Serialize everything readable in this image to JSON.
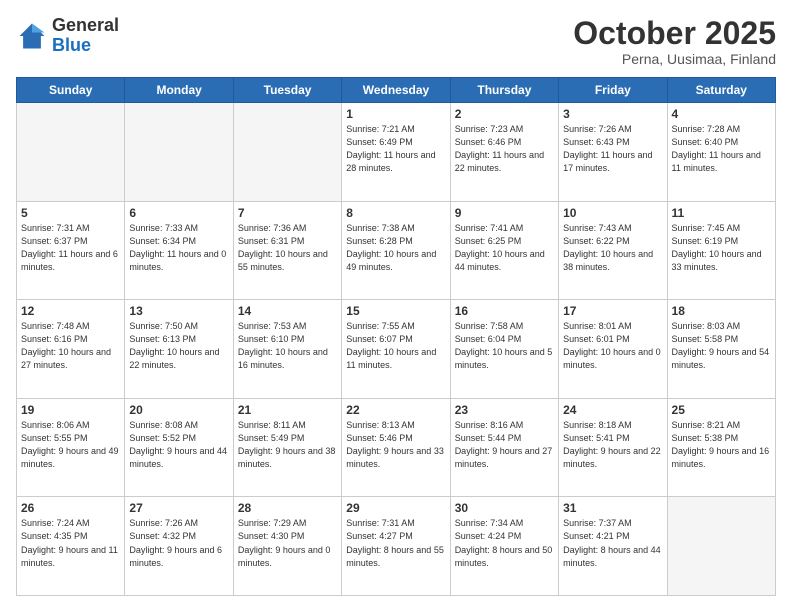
{
  "header": {
    "logo_general": "General",
    "logo_blue": "Blue",
    "month_title": "October 2025",
    "location": "Perna, Uusimaa, Finland"
  },
  "weekdays": [
    "Sunday",
    "Monday",
    "Tuesday",
    "Wednesday",
    "Thursday",
    "Friday",
    "Saturday"
  ],
  "weeks": [
    [
      {
        "day": "",
        "sunrise": "",
        "sunset": "",
        "daylight": "",
        "empty": true
      },
      {
        "day": "",
        "sunrise": "",
        "sunset": "",
        "daylight": "",
        "empty": true
      },
      {
        "day": "",
        "sunrise": "",
        "sunset": "",
        "daylight": "",
        "empty": true
      },
      {
        "day": "1",
        "sunrise": "Sunrise: 7:21 AM",
        "sunset": "Sunset: 6:49 PM",
        "daylight": "Daylight: 11 hours and 28 minutes.",
        "empty": false
      },
      {
        "day": "2",
        "sunrise": "Sunrise: 7:23 AM",
        "sunset": "Sunset: 6:46 PM",
        "daylight": "Daylight: 11 hours and 22 minutes.",
        "empty": false
      },
      {
        "day": "3",
        "sunrise": "Sunrise: 7:26 AM",
        "sunset": "Sunset: 6:43 PM",
        "daylight": "Daylight: 11 hours and 17 minutes.",
        "empty": false
      },
      {
        "day": "4",
        "sunrise": "Sunrise: 7:28 AM",
        "sunset": "Sunset: 6:40 PM",
        "daylight": "Daylight: 11 hours and 11 minutes.",
        "empty": false
      }
    ],
    [
      {
        "day": "5",
        "sunrise": "Sunrise: 7:31 AM",
        "sunset": "Sunset: 6:37 PM",
        "daylight": "Daylight: 11 hours and 6 minutes.",
        "empty": false
      },
      {
        "day": "6",
        "sunrise": "Sunrise: 7:33 AM",
        "sunset": "Sunset: 6:34 PM",
        "daylight": "Daylight: 11 hours and 0 minutes.",
        "empty": false
      },
      {
        "day": "7",
        "sunrise": "Sunrise: 7:36 AM",
        "sunset": "Sunset: 6:31 PM",
        "daylight": "Daylight: 10 hours and 55 minutes.",
        "empty": false
      },
      {
        "day": "8",
        "sunrise": "Sunrise: 7:38 AM",
        "sunset": "Sunset: 6:28 PM",
        "daylight": "Daylight: 10 hours and 49 minutes.",
        "empty": false
      },
      {
        "day": "9",
        "sunrise": "Sunrise: 7:41 AM",
        "sunset": "Sunset: 6:25 PM",
        "daylight": "Daylight: 10 hours and 44 minutes.",
        "empty": false
      },
      {
        "day": "10",
        "sunrise": "Sunrise: 7:43 AM",
        "sunset": "Sunset: 6:22 PM",
        "daylight": "Daylight: 10 hours and 38 minutes.",
        "empty": false
      },
      {
        "day": "11",
        "sunrise": "Sunrise: 7:45 AM",
        "sunset": "Sunset: 6:19 PM",
        "daylight": "Daylight: 10 hours and 33 minutes.",
        "empty": false
      }
    ],
    [
      {
        "day": "12",
        "sunrise": "Sunrise: 7:48 AM",
        "sunset": "Sunset: 6:16 PM",
        "daylight": "Daylight: 10 hours and 27 minutes.",
        "empty": false
      },
      {
        "day": "13",
        "sunrise": "Sunrise: 7:50 AM",
        "sunset": "Sunset: 6:13 PM",
        "daylight": "Daylight: 10 hours and 22 minutes.",
        "empty": false
      },
      {
        "day": "14",
        "sunrise": "Sunrise: 7:53 AM",
        "sunset": "Sunset: 6:10 PM",
        "daylight": "Daylight: 10 hours and 16 minutes.",
        "empty": false
      },
      {
        "day": "15",
        "sunrise": "Sunrise: 7:55 AM",
        "sunset": "Sunset: 6:07 PM",
        "daylight": "Daylight: 10 hours and 11 minutes.",
        "empty": false
      },
      {
        "day": "16",
        "sunrise": "Sunrise: 7:58 AM",
        "sunset": "Sunset: 6:04 PM",
        "daylight": "Daylight: 10 hours and 5 minutes.",
        "empty": false
      },
      {
        "day": "17",
        "sunrise": "Sunrise: 8:01 AM",
        "sunset": "Sunset: 6:01 PM",
        "daylight": "Daylight: 10 hours and 0 minutes.",
        "empty": false
      },
      {
        "day": "18",
        "sunrise": "Sunrise: 8:03 AM",
        "sunset": "Sunset: 5:58 PM",
        "daylight": "Daylight: 9 hours and 54 minutes.",
        "empty": false
      }
    ],
    [
      {
        "day": "19",
        "sunrise": "Sunrise: 8:06 AM",
        "sunset": "Sunset: 5:55 PM",
        "daylight": "Daylight: 9 hours and 49 minutes.",
        "empty": false
      },
      {
        "day": "20",
        "sunrise": "Sunrise: 8:08 AM",
        "sunset": "Sunset: 5:52 PM",
        "daylight": "Daylight: 9 hours and 44 minutes.",
        "empty": false
      },
      {
        "day": "21",
        "sunrise": "Sunrise: 8:11 AM",
        "sunset": "Sunset: 5:49 PM",
        "daylight": "Daylight: 9 hours and 38 minutes.",
        "empty": false
      },
      {
        "day": "22",
        "sunrise": "Sunrise: 8:13 AM",
        "sunset": "Sunset: 5:46 PM",
        "daylight": "Daylight: 9 hours and 33 minutes.",
        "empty": false
      },
      {
        "day": "23",
        "sunrise": "Sunrise: 8:16 AM",
        "sunset": "Sunset: 5:44 PM",
        "daylight": "Daylight: 9 hours and 27 minutes.",
        "empty": false
      },
      {
        "day": "24",
        "sunrise": "Sunrise: 8:18 AM",
        "sunset": "Sunset: 5:41 PM",
        "daylight": "Daylight: 9 hours and 22 minutes.",
        "empty": false
      },
      {
        "day": "25",
        "sunrise": "Sunrise: 8:21 AM",
        "sunset": "Sunset: 5:38 PM",
        "daylight": "Daylight: 9 hours and 16 minutes.",
        "empty": false
      }
    ],
    [
      {
        "day": "26",
        "sunrise": "Sunrise: 7:24 AM",
        "sunset": "Sunset: 4:35 PM",
        "daylight": "Daylight: 9 hours and 11 minutes.",
        "empty": false,
        "last": true
      },
      {
        "day": "27",
        "sunrise": "Sunrise: 7:26 AM",
        "sunset": "Sunset: 4:32 PM",
        "daylight": "Daylight: 9 hours and 6 minutes.",
        "empty": false,
        "last": true
      },
      {
        "day": "28",
        "sunrise": "Sunrise: 7:29 AM",
        "sunset": "Sunset: 4:30 PM",
        "daylight": "Daylight: 9 hours and 0 minutes.",
        "empty": false,
        "last": true
      },
      {
        "day": "29",
        "sunrise": "Sunrise: 7:31 AM",
        "sunset": "Sunset: 4:27 PM",
        "daylight": "Daylight: 8 hours and 55 minutes.",
        "empty": false,
        "last": true
      },
      {
        "day": "30",
        "sunrise": "Sunrise: 7:34 AM",
        "sunset": "Sunset: 4:24 PM",
        "daylight": "Daylight: 8 hours and 50 minutes.",
        "empty": false,
        "last": true
      },
      {
        "day": "31",
        "sunrise": "Sunrise: 7:37 AM",
        "sunset": "Sunset: 4:21 PM",
        "daylight": "Daylight: 8 hours and 44 minutes.",
        "empty": false,
        "last": true
      },
      {
        "day": "",
        "sunrise": "",
        "sunset": "",
        "daylight": "",
        "empty": true,
        "last": true
      }
    ]
  ]
}
